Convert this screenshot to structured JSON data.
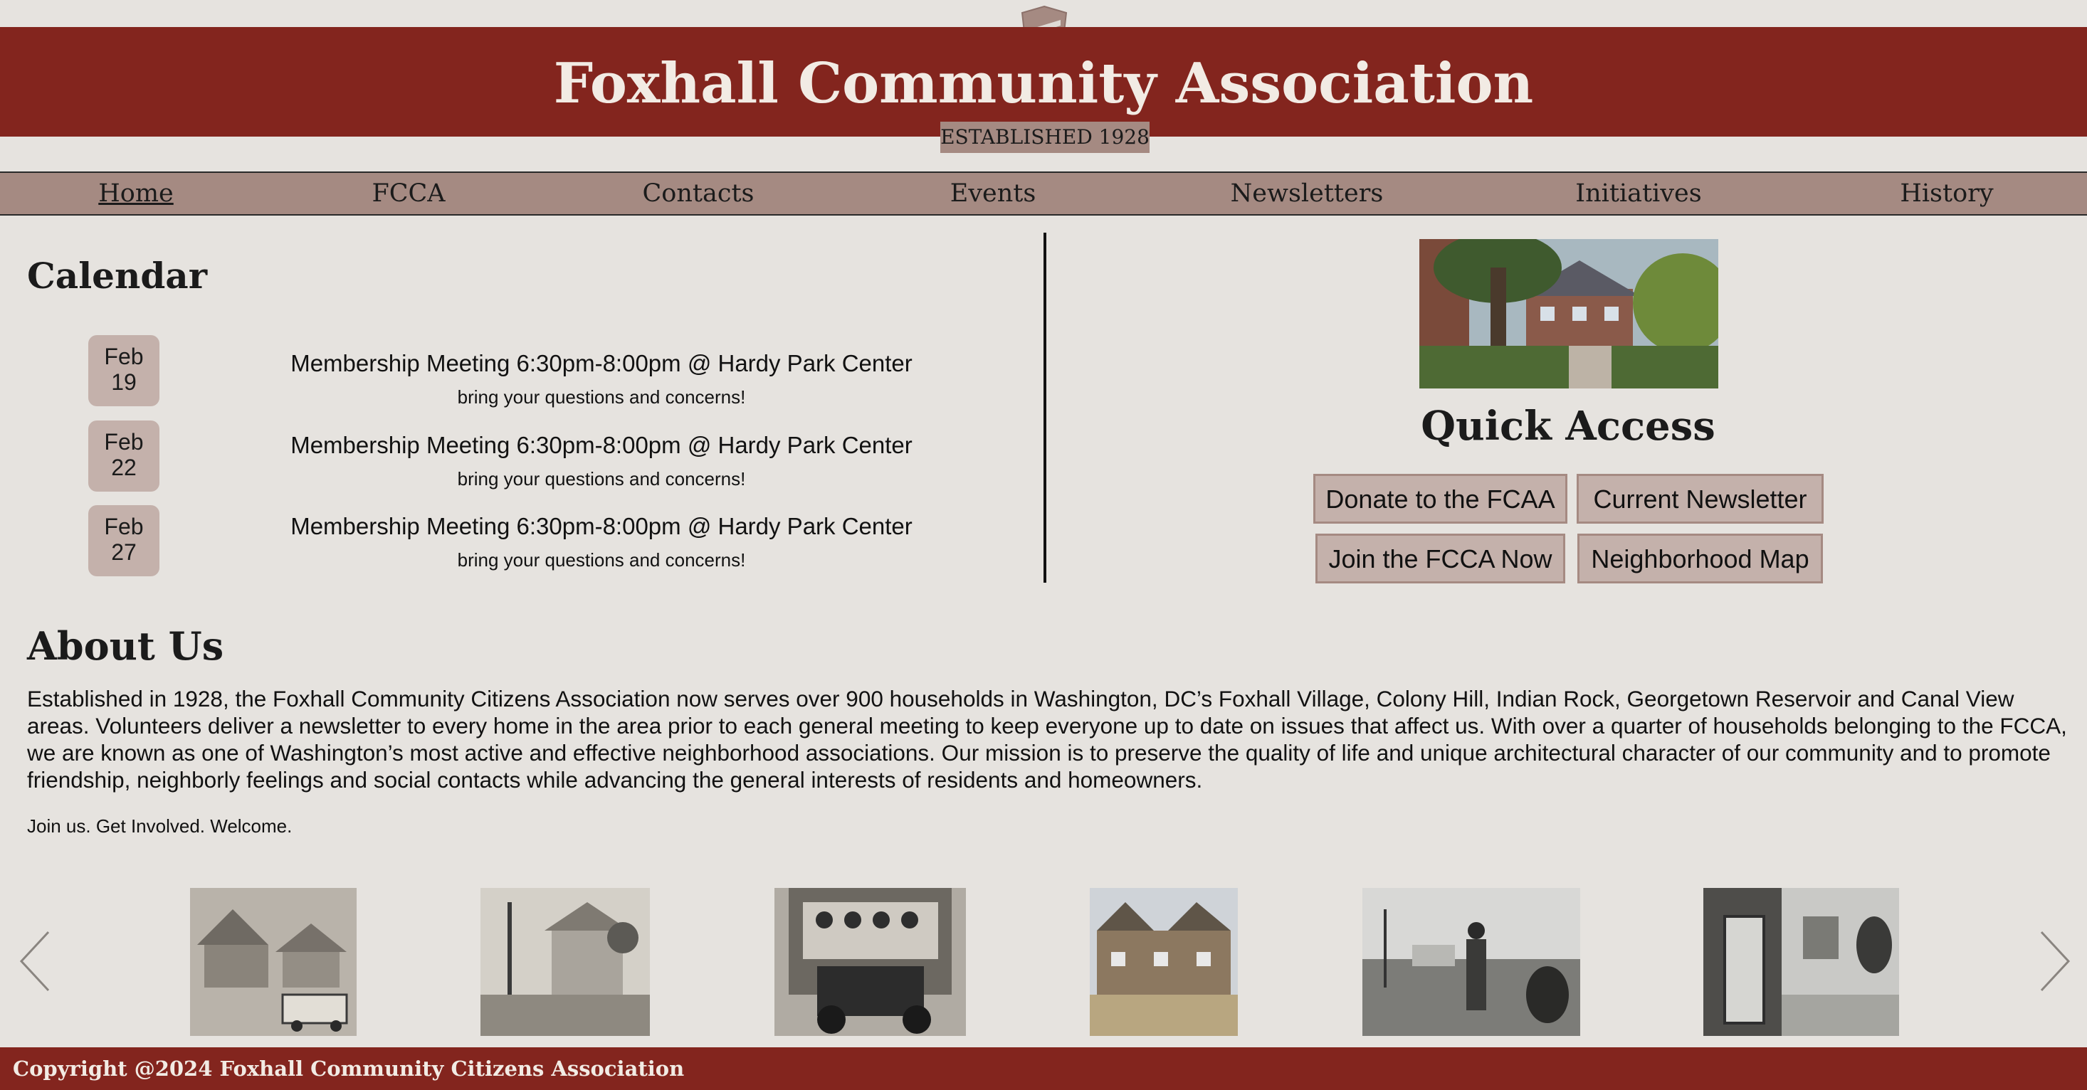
{
  "header": {
    "title": "Foxhall Community Association",
    "established": "ESTABLISHED 1928",
    "logo": "shield-logo"
  },
  "nav": {
    "items": [
      {
        "label": "Home",
        "active": true
      },
      {
        "label": "FCCA"
      },
      {
        "label": "Contacts"
      },
      {
        "label": "Events"
      },
      {
        "label": "Newsletters"
      },
      {
        "label": "Initiatives"
      },
      {
        "label": "History"
      }
    ]
  },
  "calendar": {
    "title": "Calendar",
    "events": [
      {
        "month": "Feb",
        "day": "19",
        "title": "Membership Meeting 6:30pm-8:00pm @ Hardy Park Center",
        "subtitle": "bring your questions and concerns!"
      },
      {
        "month": "Feb",
        "day": "22",
        "title": "Membership Meeting 6:30pm-8:00pm @ Hardy Park Center",
        "subtitle": "bring your questions and concerns!"
      },
      {
        "month": "Feb",
        "day": "27",
        "title": "Membership Meeting 6:30pm-8:00pm @ Hardy Park Center",
        "subtitle": "bring your questions and concerns!"
      }
    ]
  },
  "quick_access": {
    "title": "Quick Access",
    "buttons": [
      {
        "label": "Donate to the FCAA"
      },
      {
        "label": "Current Newsletter"
      },
      {
        "label": "Join the FCCA Now"
      },
      {
        "label": "Neighborhood Map"
      }
    ]
  },
  "about": {
    "title": "About Us",
    "body": "Established in 1928, the Foxhall Community Citizens Association now serves over 900 households in Washington, DC’s Foxhall Village, Colony Hill, Indian Rock, Georgetown Reservoir and Canal View areas. Volunteers deliver a newsletter to every home in the area prior to each general meeting to keep everyone up to date on issues that affect us. With over a quarter of households belonging to the FCCA, we are known as one of Washington’s most active and effective neighborhood associations. Our mission is to preserve the quality of life and unique architectural character of our community and to promote friendship, neighborly feelings and social contacts while advancing the general interests of residents and homeowners.",
    "tagline": "Join us. Get Involved. Welcome."
  },
  "carousel": {
    "prev_icon": "chevron-left-icon",
    "next_icon": "chevron-right-icon",
    "photo_count": 6
  },
  "footer": {
    "copyright": "Copyright @2024 Foxhall Community Citizens Association"
  },
  "colors": {
    "brand_red": "#83251e",
    "nav_tan": "#a58a82",
    "button_tan": "#c4b1ab",
    "background": "#e6e3df"
  }
}
